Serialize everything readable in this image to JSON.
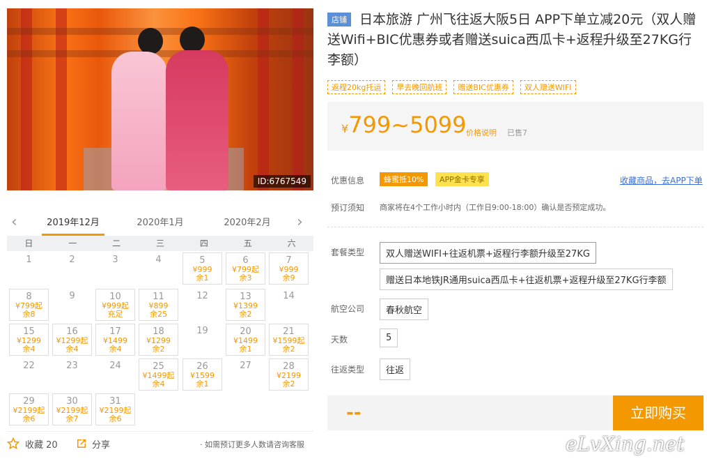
{
  "hero": {
    "id_label": "ID:6767549"
  },
  "calendar": {
    "months": [
      "2019年12月",
      "2020年1月",
      "2020年2月"
    ],
    "weekdays": [
      "日",
      "一",
      "二",
      "三",
      "四",
      "五",
      "六"
    ],
    "days": [
      {
        "d": "1"
      },
      {
        "d": "2"
      },
      {
        "d": "3"
      },
      {
        "d": "4"
      },
      {
        "d": "5",
        "p": "¥999",
        "s": "余1"
      },
      {
        "d": "6",
        "p": "¥799起",
        "s": "余3"
      },
      {
        "d": "7",
        "p": "¥999",
        "s": "余9"
      },
      {
        "d": "8",
        "p": "¥799起",
        "s": "余8"
      },
      {
        "d": "9"
      },
      {
        "d": "10",
        "p": "¥999起",
        "s": "充足"
      },
      {
        "d": "11",
        "p": "¥899",
        "s": "余25"
      },
      {
        "d": "12"
      },
      {
        "d": "13",
        "p": "¥1399",
        "s": "余2"
      },
      {
        "d": "14"
      },
      {
        "d": "15",
        "p": "¥1299",
        "s": "余4"
      },
      {
        "d": "16",
        "p": "¥1299起",
        "s": "余4"
      },
      {
        "d": "17",
        "p": "¥1499",
        "s": "余4"
      },
      {
        "d": "18",
        "p": "¥1299",
        "s": "余2"
      },
      {
        "d": "19"
      },
      {
        "d": "20",
        "p": "¥1499",
        "s": "余1"
      },
      {
        "d": "21",
        "p": "¥1599起",
        "s": "余2"
      },
      {
        "d": "22"
      },
      {
        "d": "23"
      },
      {
        "d": "24"
      },
      {
        "d": "25",
        "p": "¥1499起",
        "s": "余4"
      },
      {
        "d": "26",
        "p": "¥1599",
        "s": "余1"
      },
      {
        "d": "27"
      },
      {
        "d": "28",
        "p": "¥2199",
        "s": "余2"
      },
      {
        "d": "29",
        "p": "¥2199起",
        "s": "余6"
      },
      {
        "d": "30",
        "p": "¥2199起",
        "s": "余7"
      },
      {
        "d": "31",
        "p": "¥2199起",
        "s": "余6"
      }
    ]
  },
  "footer": {
    "collect": "收藏 20",
    "share": "分享",
    "consult": "· 如需预订更多人数请咨询客服"
  },
  "product": {
    "shop_tag": "店铺",
    "title": "日本旅游 广州飞往返大阪5日 APP下单立减20元（双人赠送Wifi+BIC优惠券或者赠送suica西瓜卡+返程升级至27KG行李额）",
    "feature_tags": [
      "返程20kg托运",
      "早去晚回航班",
      "赠送BIC优惠券",
      "双人赠送WIFI"
    ],
    "price_symbol": "¥",
    "price": "799~5099",
    "price_note": "价格说明",
    "sold": "已售7",
    "promo_label": "优惠信息",
    "promo_badges": [
      "蜂蜜抵10%",
      "APP金卡专享"
    ],
    "collect_link": "收藏商品，去APP下单",
    "notice_label": "预订须知",
    "notice_text": "商家将在4个工作小时内（工作日9:00-18:00）确认是否预定成功。",
    "package_label": "套餐类型",
    "packages": [
      "双人赠送WIFI+往返机票+返程行李额升级至27KG",
      "赠送日本地铁JR通用suica西瓜卡+往返机票+返程升级至27KG行李额"
    ],
    "airline_label": "航空公司",
    "airline": "春秋航空",
    "days_label": "天数",
    "days": "5",
    "trip_label": "往返类型",
    "trip": "往返",
    "total": "--",
    "buy": "立即购买"
  },
  "watermark": "eLvXing.net",
  "colors": {
    "accent": "#f39800",
    "shop_tag": "#5b8fd8",
    "link": "#3b6fd6"
  }
}
